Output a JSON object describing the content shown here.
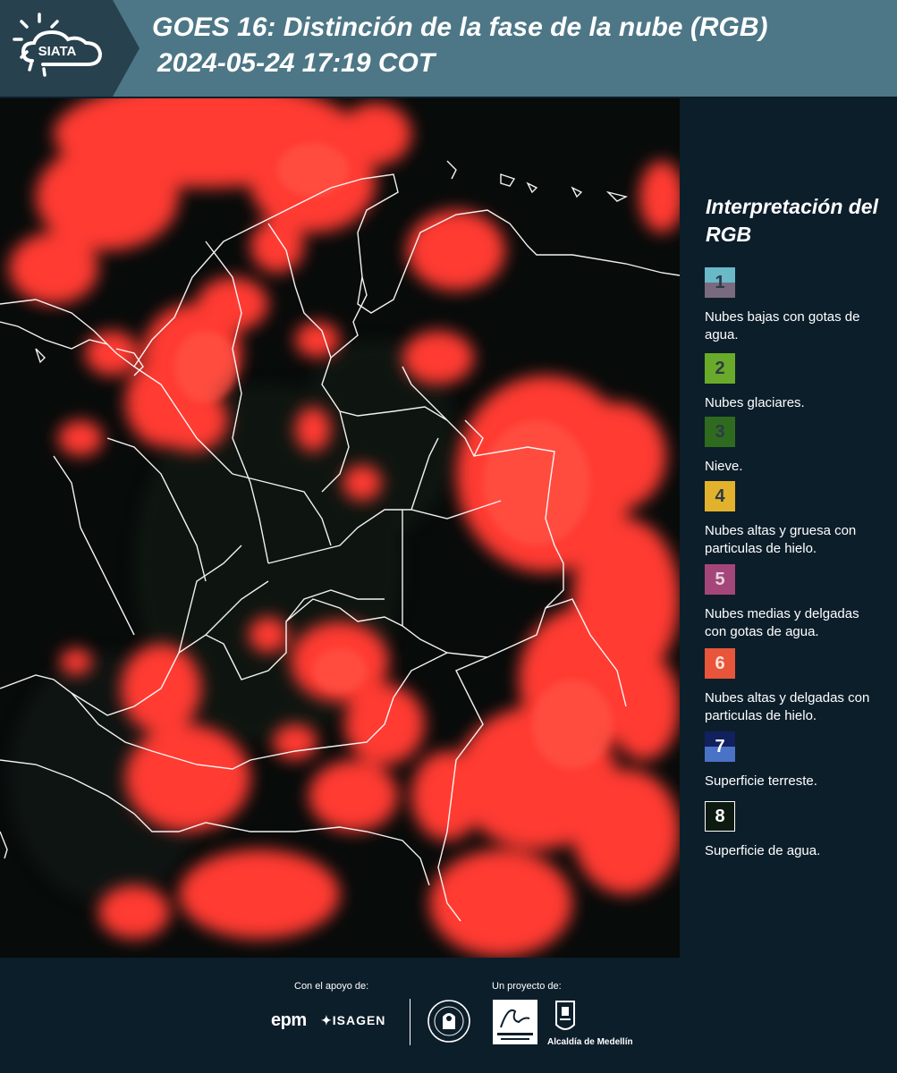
{
  "header": {
    "logo_text": "SIATA",
    "title_line1": "GOES 16: Distinción de la fase de la nube (RGB)",
    "title_line2": "2024-05-24 17:19 COT",
    "background_color": "#4d7786"
  },
  "map": {
    "satellite_product": "GOES 16 cloud phase distinction RGB",
    "dominant_cloud_color": "#ff3a30",
    "background_color": "#070b0a",
    "border_color": "#ffffff"
  },
  "legend": {
    "title": "Interpretación del RGB",
    "items": [
      {
        "number": "1",
        "label": "Nubes bajas con gotas de agua.",
        "color_top": "#69b9c8",
        "color_bottom": "#7a6a80"
      },
      {
        "number": "2",
        "label": "Nubes glaciares.",
        "color_top": "#6aaa2a",
        "color_bottom": "#6aaa2a"
      },
      {
        "number": "3",
        "label": "Nieve.",
        "color_top": "#2f6b1e",
        "color_bottom": "#2f6b1e"
      },
      {
        "number": "4",
        "label": "Nubes altas y gruesa con particulas de hielo.",
        "color_top": "#e2b22c",
        "color_bottom": "#e2b22c"
      },
      {
        "number": "5",
        "label": "Nubes medias y delgadas con gotas de agua.",
        "color_top": "#a5467a",
        "color_bottom": "#a5467a"
      },
      {
        "number": "6",
        "label": "Nubes altas y delgadas con particulas de hielo.",
        "color_top": "#e8553a",
        "color_bottom": "#e8553a"
      },
      {
        "number": "7",
        "label": "Superficie terreste.",
        "color_top": "#10215e",
        "color_bottom": "#4a72c6"
      },
      {
        "number": "8",
        "label": "Superficie de agua.",
        "color_top": "#0d1a10",
        "color_bottom": "#0d1a10"
      }
    ]
  },
  "footer": {
    "support_label": "Con el apoyo de:",
    "project_label": "Un proyecto de:",
    "sponsors": [
      "epm",
      "ISAGEN"
    ],
    "partners": [
      "Área Metropolitana Valle de Aburrá",
      "Alcaldía de Medellín"
    ],
    "medellin_label": "Alcaldía de Medellín",
    "epm_label": "epm",
    "isagen_label": "ISAGEN"
  }
}
